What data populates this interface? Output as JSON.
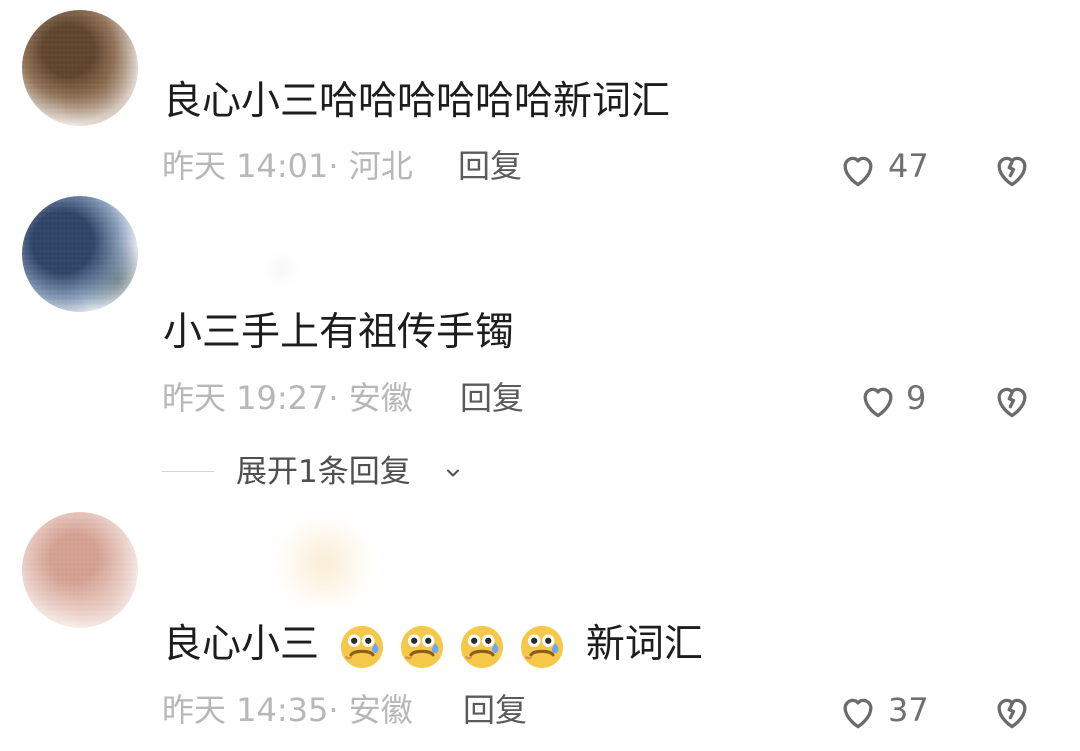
{
  "comments": [
    {
      "text": "良心小三哈哈哈哈哈哈新词汇",
      "meta": "昨天 14:01· 河北",
      "reply_label": "回复",
      "likes": "47"
    },
    {
      "text": "小三手上有祖传手镯",
      "meta": "昨天 19:27· 安徽",
      "reply_label": "回复",
      "likes": "9",
      "expand_label": "展开1条回复"
    },
    {
      "text_before": "良心小三",
      "text_after": "新词汇",
      "meta": "昨天 14:35· 安徽",
      "reply_label": "回复",
      "likes": "37",
      "emoji_name": "cold-sweat-face-emoji",
      "emoji_count": 4
    }
  ],
  "icons": {
    "like": "heart-outline-icon",
    "dislike": "broken-heart-icon",
    "expand": "chevron-down-icon"
  },
  "colors": {
    "text": "#1d1d1d",
    "meta": "#b7b7b7",
    "action": "#5b5b5b",
    "icon": "#6b6b6b",
    "emoji_yellow": "#f6c84a",
    "emoji_blue": "#6ba7ff"
  }
}
